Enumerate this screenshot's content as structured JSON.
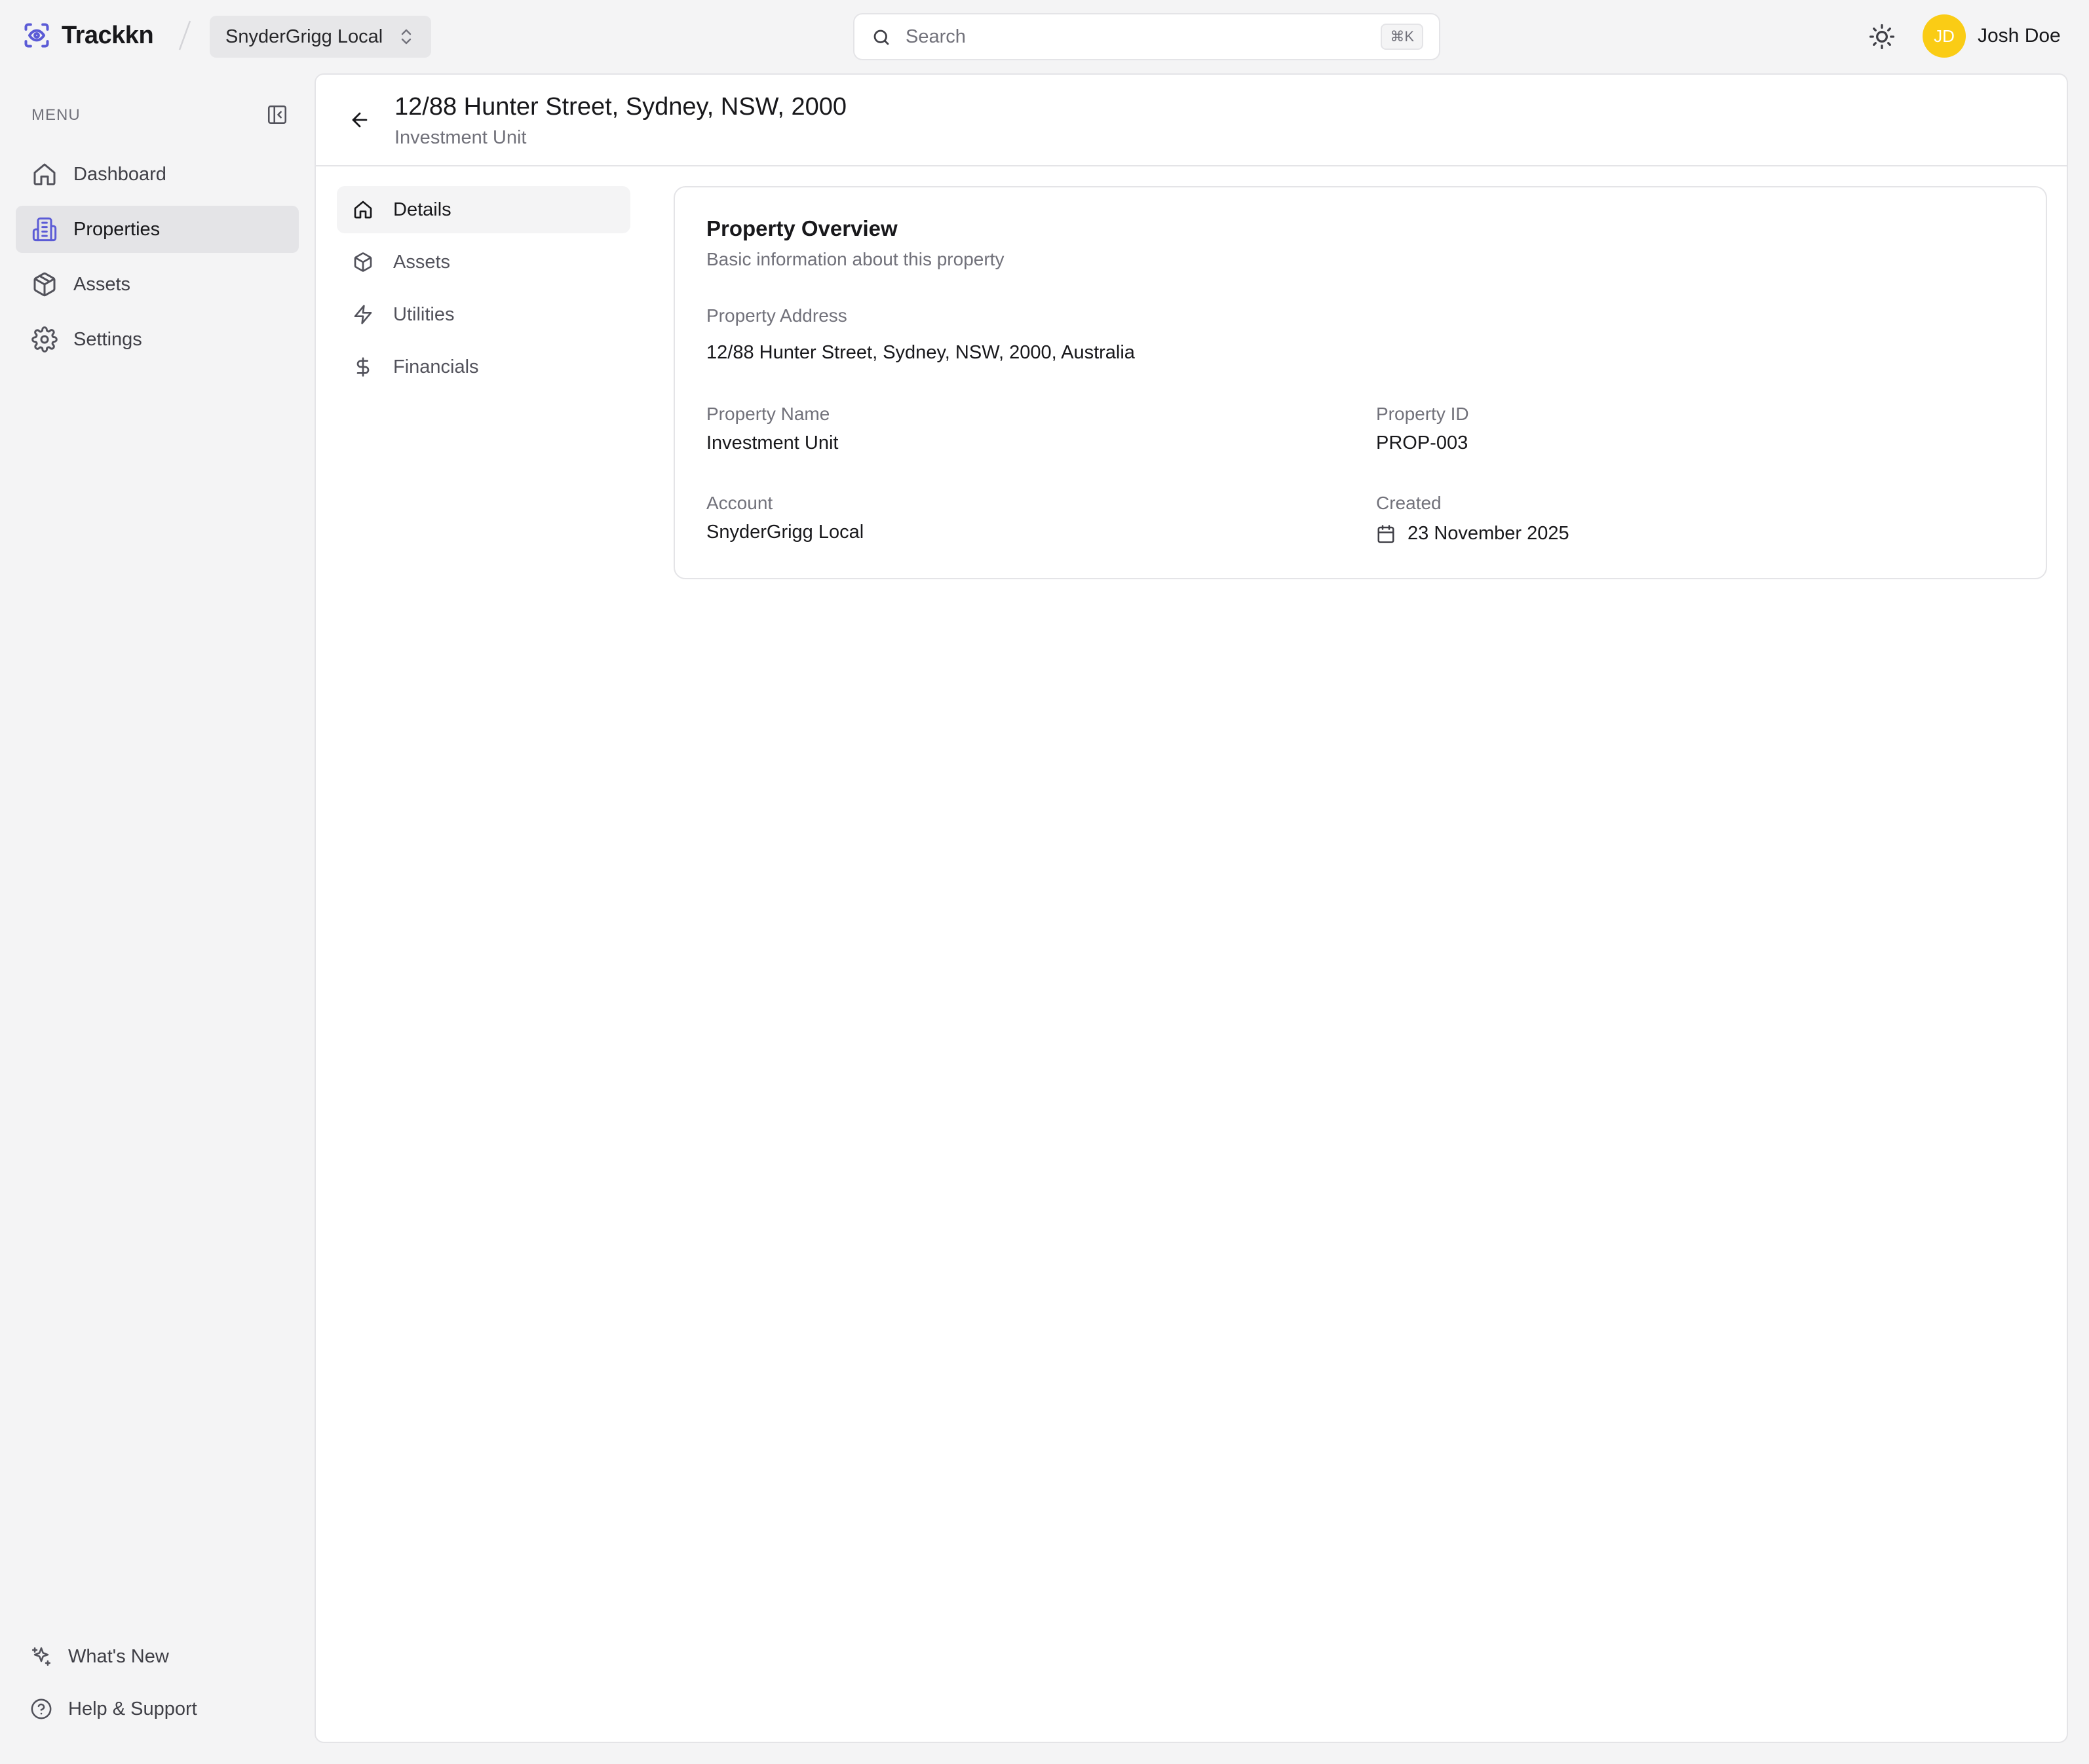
{
  "brand": {
    "name": "Trackkn",
    "accent": "#5b5bd6"
  },
  "account_switcher": {
    "label": "SnyderGrigg Local"
  },
  "search": {
    "placeholder": "Search",
    "shortcut": "⌘K"
  },
  "user": {
    "initials": "JD",
    "name": "Josh Doe",
    "avatar_color": "#facc15"
  },
  "sidebar": {
    "menu_label": "MENU",
    "items": [
      {
        "label": "Dashboard",
        "icon": "home-icon",
        "active": false
      },
      {
        "label": "Properties",
        "icon": "building-icon",
        "active": true
      },
      {
        "label": "Assets",
        "icon": "box-icon",
        "active": false
      },
      {
        "label": "Settings",
        "icon": "gear-icon",
        "active": false
      }
    ],
    "footer": [
      {
        "label": "What's New",
        "icon": "sparkles-icon"
      },
      {
        "label": "Help & Support",
        "icon": "help-circle-icon"
      }
    ]
  },
  "page": {
    "title": "12/88 Hunter Street, Sydney, NSW, 2000",
    "subtitle": "Investment Unit"
  },
  "subnav": [
    {
      "label": "Details",
      "icon": "home-icon",
      "active": true
    },
    {
      "label": "Assets",
      "icon": "box-icon",
      "active": false
    },
    {
      "label": "Utilities",
      "icon": "zap-icon",
      "active": false
    },
    {
      "label": "Financials",
      "icon": "dollar-icon",
      "active": false
    }
  ],
  "overview": {
    "title": "Property Overview",
    "subtitle": "Basic information about this property",
    "address_label": "Property Address",
    "address_value": "12/88 Hunter Street, Sydney, NSW, 2000, Australia",
    "name_label": "Property Name",
    "name_value": "Investment Unit",
    "id_label": "Property ID",
    "id_value": "PROP-003",
    "account_label": "Account",
    "account_value": "SnyderGrigg Local",
    "created_label": "Created",
    "created_value": "23 November 2025"
  }
}
